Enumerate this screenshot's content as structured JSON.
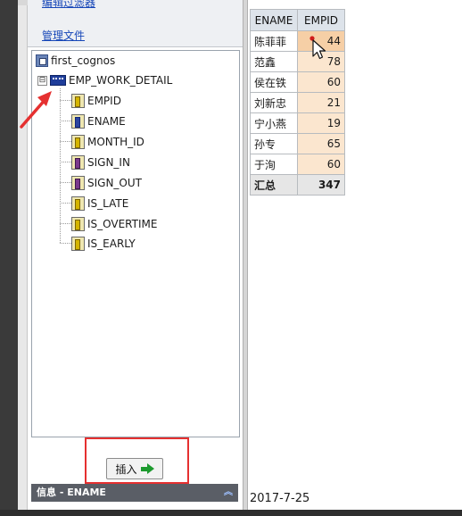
{
  "pane": {
    "cut_link": "编辑过滤器",
    "manage_link": "管理文件",
    "tree": {
      "package": "first_cognos",
      "query_subject": "EMP_WORK_DETAIL",
      "items": [
        {
          "label": "EMPID",
          "icon": "query-item-icon"
        },
        {
          "label": "ENAME",
          "icon": "query-item-icon-dark"
        },
        {
          "label": "MONTH_ID",
          "icon": "query-item-icon"
        },
        {
          "label": "SIGN_IN",
          "icon": "query-item-icon-split"
        },
        {
          "label": "SIGN_OUT",
          "icon": "query-item-icon-split"
        },
        {
          "label": "IS_LATE",
          "icon": "query-item-icon"
        },
        {
          "label": "IS_OVERTIME",
          "icon": "query-item-icon"
        },
        {
          "label": "IS_EARLY",
          "icon": "query-item-icon"
        }
      ],
      "expander_symbol": "⊟"
    },
    "insert_button": "插入",
    "info_bar": "信息 - ENAME",
    "info_collapse": "︽"
  },
  "report": {
    "headers": [
      "ENAME",
      "EMPID"
    ],
    "rows": [
      {
        "name": "陈菲菲",
        "id": "44"
      },
      {
        "name": "范鑫",
        "id": "78"
      },
      {
        "name": "侯在铁",
        "id": "60"
      },
      {
        "name": "刘新忠",
        "id": "21"
      },
      {
        "name": "宁小燕",
        "id": "19"
      },
      {
        "name": "孙专",
        "id": "65"
      },
      {
        "name": "于洵",
        "id": "60"
      }
    ],
    "total_label": "汇总",
    "total_value": "347",
    "date": "2017-7-25"
  },
  "colors": {
    "annotation_red": "#e53030",
    "measure_cell": "#fbe6cf",
    "header_cell": "#dde3ea",
    "link_blue": "#1747b8"
  }
}
